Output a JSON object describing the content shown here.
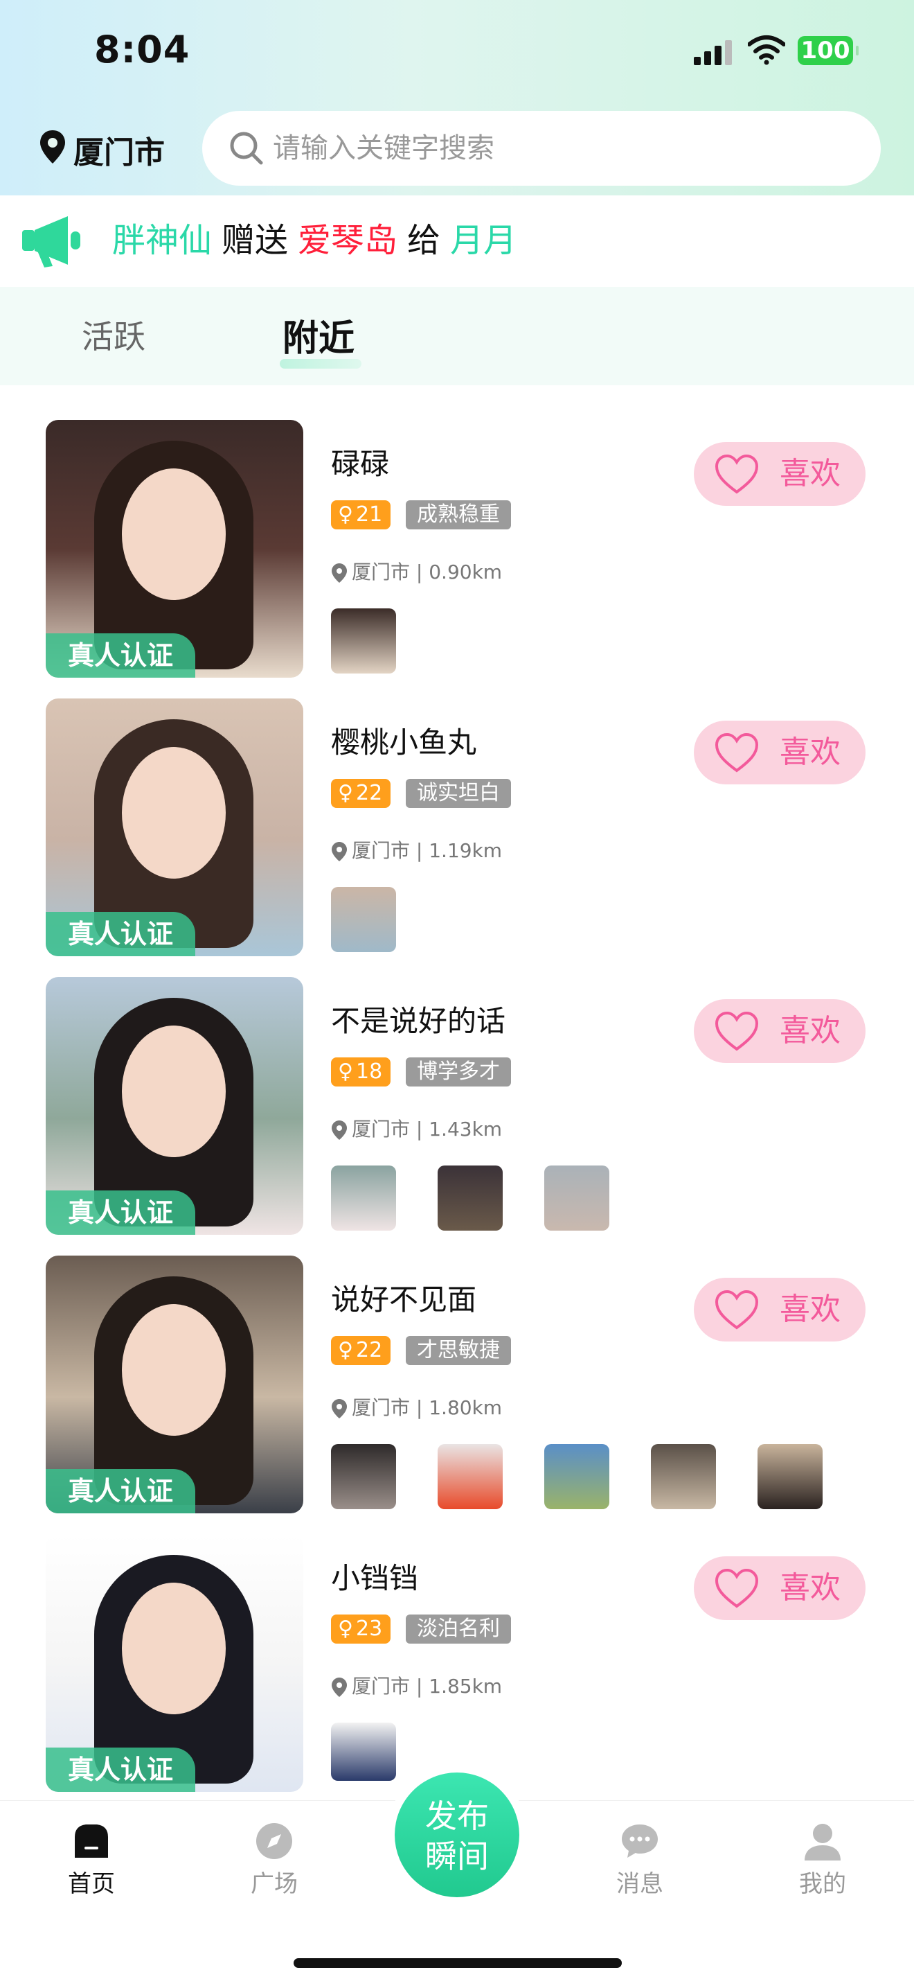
{
  "status_bar": {
    "time": "8:04",
    "battery": "100"
  },
  "header": {
    "city": "厦门市",
    "search_placeholder": "请输入关键字搜索"
  },
  "gift_banner": {
    "sender": "胖神仙",
    "verb": "赠送",
    "gift": "爱琴岛",
    "to": "给",
    "receiver": "月月"
  },
  "tabs": [
    {
      "label": "活跃",
      "active": false
    },
    {
      "label": "附近",
      "active": true
    }
  ],
  "users": [
    {
      "name": "碌碌",
      "age": "21",
      "trait": "成熟稳重",
      "location": "厦门市 | 0.90km",
      "verified": "真人认证",
      "like": "喜欢",
      "thumb_count": 1
    },
    {
      "name": "樱桃小鱼丸",
      "age": "22",
      "trait": "诚实坦白",
      "location": "厦门市 | 1.19km",
      "verified": "真人认证",
      "like": "喜欢",
      "thumb_count": 1
    },
    {
      "name": "不是说好的话",
      "age": "18",
      "trait": "博学多才",
      "location": "厦门市 | 1.43km",
      "verified": "真人认证",
      "like": "喜欢",
      "thumb_count": 3
    },
    {
      "name": "说好不见面",
      "age": "22",
      "trait": "才思敏捷",
      "location": "厦门市 | 1.80km",
      "verified": "真人认证",
      "like": "喜欢",
      "thumb_count": 5
    },
    {
      "name": "小铛铛",
      "age": "23",
      "trait": "淡泊名利",
      "location": "厦门市 | 1.85km",
      "verified": "真人认证",
      "like": "喜欢",
      "thumb_count": 1
    }
  ],
  "bottom_nav": {
    "home": "首页",
    "plaza": "广场",
    "publish": "发布瞬间",
    "messages": "消息",
    "mine": "我的"
  },
  "colors": {
    "accent_green": "#2ad8a8",
    "gift_red": "#ff1f3a",
    "like_pink": "#f35a9b",
    "age_orange": "#ff9f1c"
  }
}
